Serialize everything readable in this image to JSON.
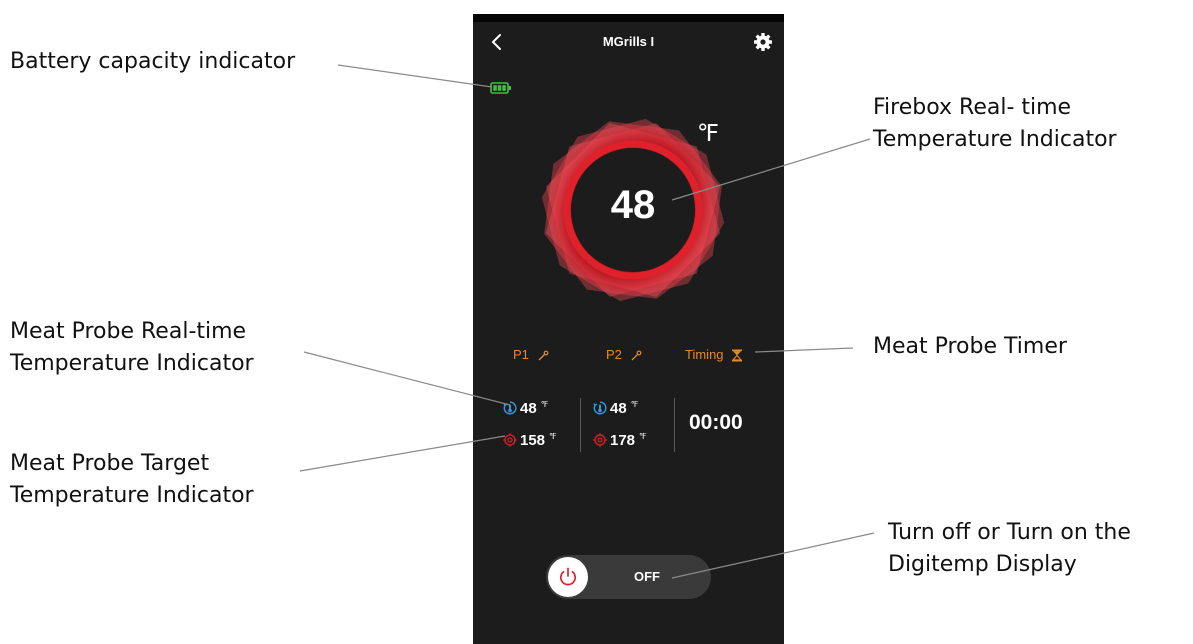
{
  "callouts": {
    "battery": "Battery capacity indicator",
    "firebox": "Firebox Real- time\nTemperature Indicator",
    "meat_realtime": "Meat Probe Real-time\nTemperature Indicator",
    "timer": "Meat Probe Timer",
    "meat_target": "Meat Probe Target\nTemperature Indicator",
    "display": "Turn off or Turn on the\nDigitemp Display"
  },
  "header": {
    "back_icon": "chevron-left-icon",
    "title": "MGrills I",
    "settings_icon": "gear-icon"
  },
  "battery": {
    "icon": "battery-icon",
    "color": "#3fbf3f"
  },
  "firebox": {
    "unit": "℉",
    "temperature": "48",
    "ring_color": "#e0202a"
  },
  "tabs": [
    {
      "label": "P1",
      "icon": "probe-icon"
    },
    {
      "label": "P2",
      "icon": "probe-icon"
    },
    {
      "label": "Timing",
      "icon": "hourglass-icon"
    }
  ],
  "probes": {
    "p1": {
      "current": "48",
      "target": "158",
      "unit": "℉"
    },
    "p2": {
      "current": "48",
      "target": "178",
      "unit": "℉"
    }
  },
  "timer": {
    "value": "00:00"
  },
  "power": {
    "label": "OFF",
    "icon": "power-icon"
  },
  "colors": {
    "accent": "#e8892a",
    "current_icon": "#2a9fe0",
    "target_icon": "#e0202a",
    "background": "#1c1c1c"
  }
}
